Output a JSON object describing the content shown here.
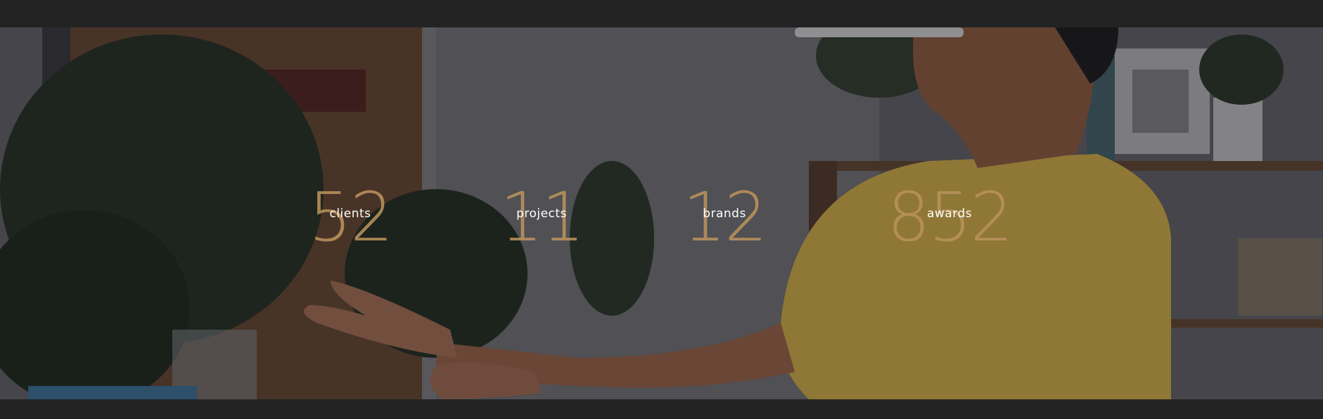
{
  "stats": [
    {
      "number": "52",
      "label": "clients"
    },
    {
      "number": "11",
      "label": "projects"
    },
    {
      "number": "12",
      "label": "brands"
    },
    {
      "number": "852",
      "label": "awards"
    }
  ],
  "colors": {
    "page_background": "#232323",
    "number_color": "#ba925c",
    "label_color": "#ffffff"
  }
}
